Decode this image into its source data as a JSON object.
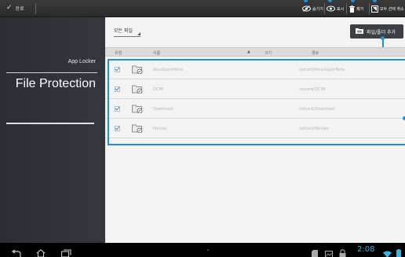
{
  "action_bar": {
    "done_label": "완료",
    "actions": [
      {
        "label": "숨기기",
        "icon": "eye-hide-icon"
      },
      {
        "label": "표시",
        "icon": "eye-show-icon"
      },
      {
        "label": "제거",
        "icon": "trash-icon"
      },
      {
        "label": "모두 선택 취소",
        "icon": "deselect-all-icon"
      }
    ],
    "accent_color": "#1a8fe3"
  },
  "left_pane": {
    "app_name": "App Locker",
    "title": "File Protection"
  },
  "main": {
    "filter_label": "모든 파일",
    "add_button_label": "파일/폴더 추가",
    "columns": [
      "유형",
      "이름",
      "크기",
      "경로"
    ],
    "rows": [
      {
        "name": "AsusSuperNote",
        "size": "",
        "path": "/sdcard/AsusSuperNote",
        "checked": true
      },
      {
        "name": "DCIM",
        "size": "",
        "path": "/sdcard/DCIM",
        "checked": true
      },
      {
        "name": "Download",
        "size": "",
        "path": "/sdcard/Download",
        "checked": true
      },
      {
        "name": "Movies",
        "size": "",
        "path": "/sdcard/Movies",
        "checked": true
      }
    ]
  },
  "status_bar": {
    "time": "2:08"
  }
}
